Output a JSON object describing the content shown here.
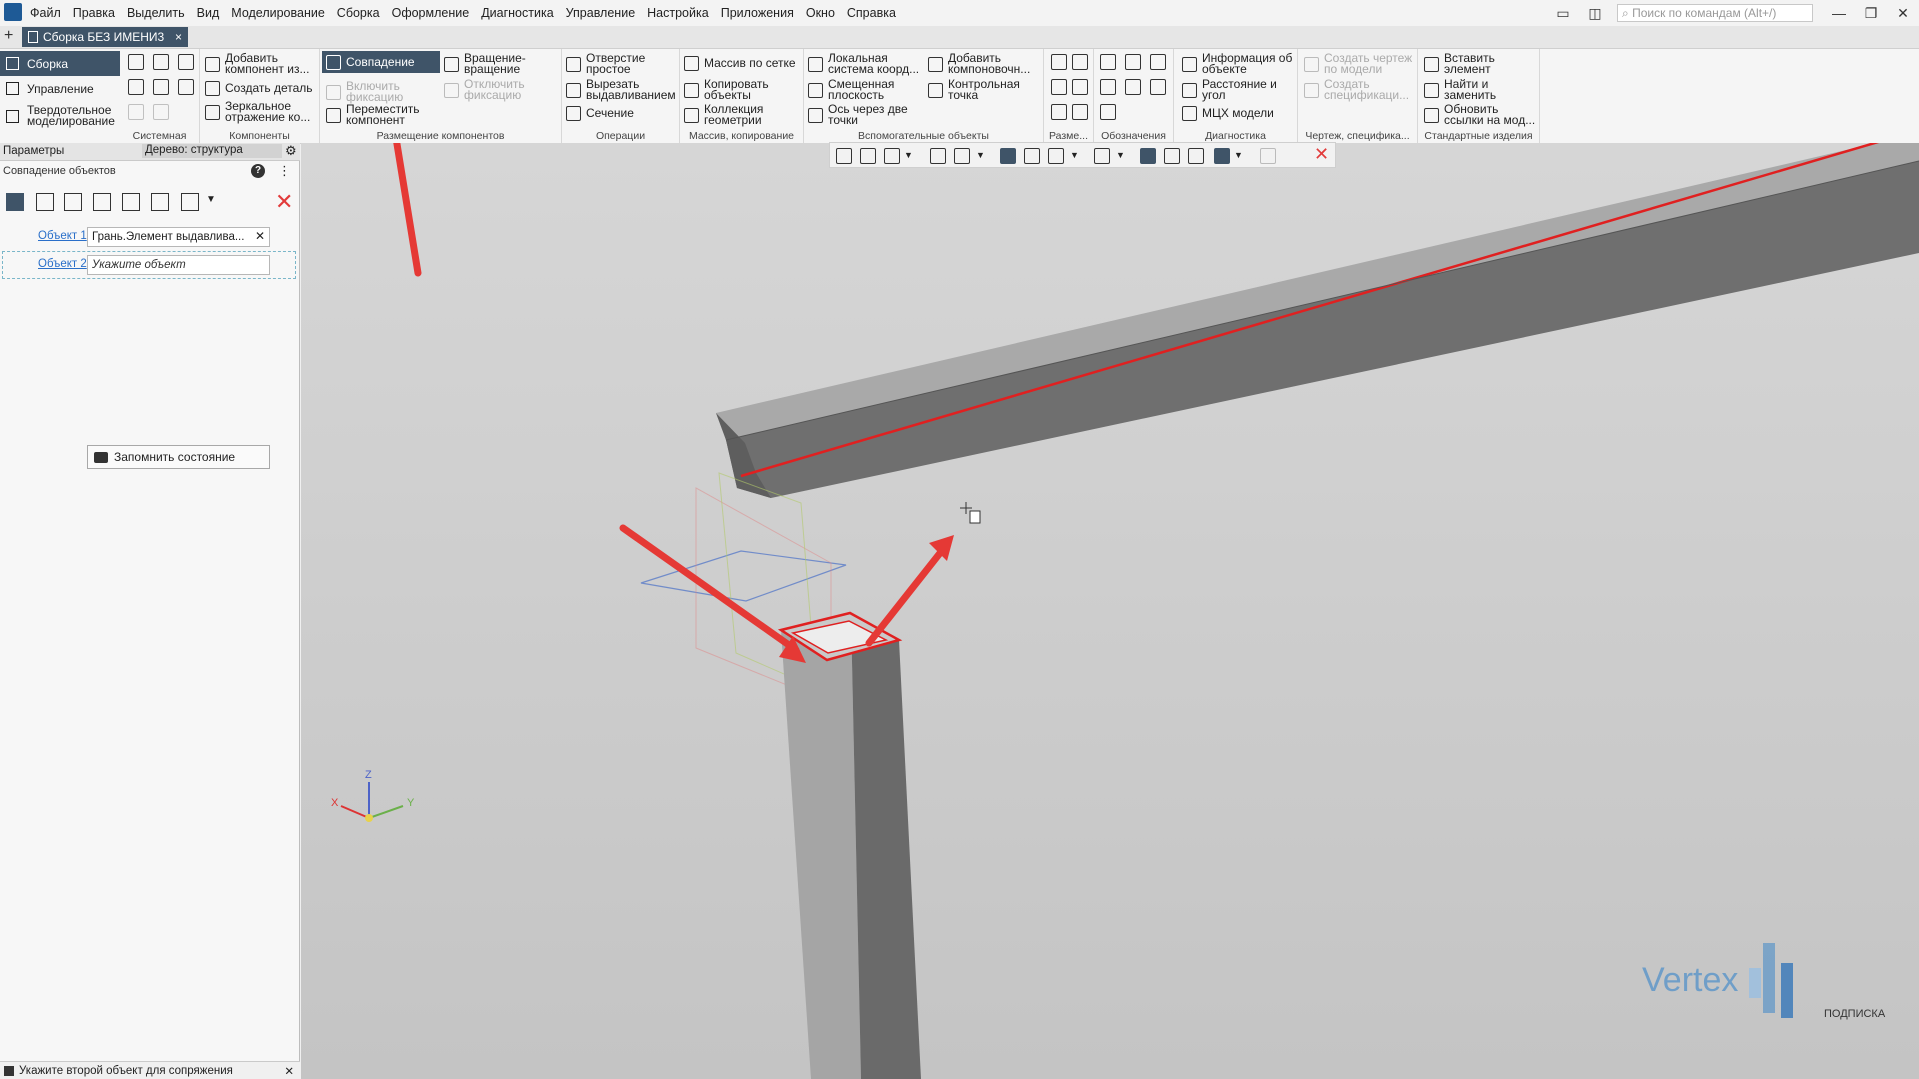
{
  "menu": {
    "items": [
      "Файл",
      "Правка",
      "Выделить",
      "Вид",
      "Моделирование",
      "Сборка",
      "Оформление",
      "Диагностика",
      "Управление",
      "Настройка",
      "Приложения",
      "Окно",
      "Справка"
    ],
    "search_placeholder": "Поиск по командам (Alt+/)"
  },
  "tab": {
    "plus": "+",
    "title": "Сборка БЕЗ ИМЕНИ3",
    "close": "×"
  },
  "ribbon": {
    "nav": [
      "Сборка",
      "Управление",
      "Твердотельное моделирование"
    ],
    "groups": {
      "system": "Системная",
      "components": "Компоненты",
      "placement": "Размещение компонентов",
      "operations": "Операции",
      "array": "Массив, копирование",
      "aux": "Вспомогательные объекты",
      "dims": "Разме...",
      "designations": "Обозначения",
      "diagnostics": "Диагностика",
      "drawing": "Чертеж, специфика...",
      "standard": "Стандартные изделия"
    },
    "items": {
      "add_component": "Добавить компонент из...",
      "create_part": "Создать деталь",
      "mirror": "Зеркальное отражение ко...",
      "coincidence": "Совпадение",
      "rotation": "Вращение-вращение",
      "enable_fix": "Включить фиксацию",
      "disable_fix": "Отключить фиксацию",
      "move_component": "Переместить компонент",
      "hole": "Отверстие простое",
      "cut_extrude": "Вырезать выдавливанием",
      "section": "Сечение",
      "grid_array": "Массив по сетке",
      "copy_objects": "Копировать объекты",
      "geometry_collection": "Коллекция геометрии",
      "local_cs": "Локальная система коорд...",
      "offset_plane": "Смещенная плоскость",
      "axis_two_points": "Ось через две точки",
      "add_layout": "Добавить компоновочн...",
      "control_point": "Контрольная точка",
      "object_info": "Информация об объекте",
      "distance_angle": "Расстояние и угол",
      "mass_props": "МЦХ модели",
      "create_drawing": "Создать чертеж по модели",
      "create_spec": "Создать спецификаци...",
      "insert_element": "Вставить элемент",
      "find_replace": "Найти и заменить",
      "update_links": "Обновить ссылки на мод..."
    }
  },
  "panel": {
    "params_tab": "Параметры",
    "tree_tab": "Дерево: структура",
    "subtitle": "Совпадение объектов",
    "object1_label": "Объект 1",
    "object1_value": "Грань.Элемент выдавлива...",
    "object2_label": "Объект 2",
    "object2_placeholder": "Укажите объект",
    "remember_button": "Запомнить состояние"
  },
  "status": {
    "text": "Укажите второй объект для сопряжения"
  },
  "viewport": {
    "watermark": "Vertex",
    "watermark_sub": "ПОДПИСКА",
    "axes": [
      "Z",
      "X",
      "Y"
    ],
    "highlight_color": "#e02020",
    "arrow_color": "#e53935"
  }
}
